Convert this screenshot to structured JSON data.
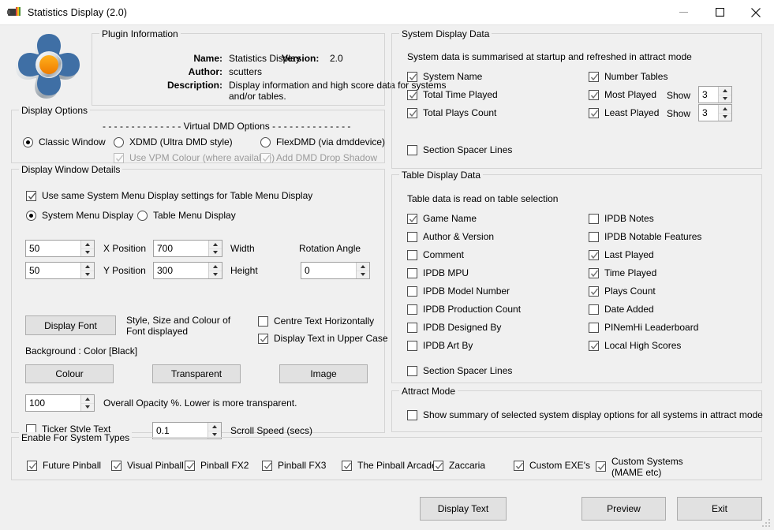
{
  "window": {
    "title": "Statistics Display (2.0)",
    "icon": "plugin-icon",
    "minimize": "–",
    "maximize": "□",
    "close": "✕"
  },
  "plugin_information": {
    "group_title": "Plugin Information",
    "name_label": "Name:",
    "name_value": "Statistics Display",
    "version_label": "Version:",
    "version_value": "2.0",
    "author_label": "Author:",
    "author_value": "scutters",
    "description_label": "Description:",
    "description_value_line1": "Display information and high score data for systems",
    "description_value_line2": "and/or tables."
  },
  "display_options": {
    "group_title": "Display Options",
    "virtual_dmd_header": "- - - - - - - - - - - - - -  Virtual DMD Options  - - - - - - - - - - - - - -",
    "radios": [
      {
        "label": "Classic Window",
        "checked": true
      },
      {
        "label": "XDMD (Ultra DMD style)",
        "checked": false
      },
      {
        "label": "FlexDMD (via dmddevice)",
        "checked": false
      }
    ],
    "checkboxes": [
      {
        "label": "Use VPM Colour (where available)",
        "checked": true,
        "disabled": true
      },
      {
        "label": "Add DMD Drop Shadow",
        "checked": true,
        "disabled": true
      }
    ]
  },
  "display_window_details": {
    "group_title": "Display Window Details",
    "use_same_settings": {
      "label": "Use same System Menu Display settings for Table Menu Display",
      "checked": true
    },
    "menu_radios": [
      {
        "label": "System Menu Display",
        "checked": true
      },
      {
        "label": "Table Menu Display",
        "checked": false
      }
    ],
    "x_position": {
      "value": "50",
      "label": "X Position"
    },
    "y_position": {
      "value": "50",
      "label": "Y Position"
    },
    "width": {
      "value": "700",
      "label": "Width"
    },
    "height": {
      "value": "300",
      "label": "Height"
    },
    "rotation_angle": {
      "value": "0",
      "label": "Rotation Angle"
    },
    "display_font_button": "Display Font",
    "font_note_line1": "Style, Size and Colour of",
    "font_note_line2": "Font displayed",
    "centre_text": {
      "label": "Centre Text Horizontally",
      "checked": false
    },
    "upper_case": {
      "label": "Display Text in Upper Case",
      "checked": true
    },
    "background_label": "Background : Color [Black]",
    "colour_button": "Colour",
    "transparent_button": "Transparent",
    "image_button": "Image",
    "opacity": {
      "value": "100",
      "label": "Overall Opacity %. Lower is more transparent."
    },
    "ticker_style": {
      "label": "Ticker Style Text",
      "checked": false
    },
    "scroll_speed": {
      "value": "0.1",
      "label": "Scroll Speed (secs)"
    }
  },
  "system_display_data": {
    "group_title": "System Display Data",
    "note": "System data is summarised at startup and refreshed in attract mode",
    "left_column": [
      {
        "label": "System Name",
        "checked": true
      },
      {
        "label": "Total Time Played",
        "checked": true
      },
      {
        "label": "Total Plays Count",
        "checked": true
      }
    ],
    "right_column": [
      {
        "label": "Number Tables",
        "checked": true
      },
      {
        "label": "Most Played",
        "checked": true,
        "show_label": "Show",
        "show_value": "3"
      },
      {
        "label": "Least Played",
        "checked": true,
        "show_label": "Show",
        "show_value": "3"
      }
    ],
    "section_spacer": {
      "label": "Section Spacer Lines",
      "checked": false
    }
  },
  "table_display_data": {
    "group_title": "Table Display Data",
    "note": "Table data is read on table selection",
    "left_column": [
      {
        "label": "Game Name",
        "checked": true
      },
      {
        "label": "Author & Version",
        "checked": false
      },
      {
        "label": "Comment",
        "checked": false
      },
      {
        "label": "IPDB MPU",
        "checked": false
      },
      {
        "label": "IPDB Model Number",
        "checked": false
      },
      {
        "label": "IPDB Production Count",
        "checked": false
      },
      {
        "label": "IPDB Designed By",
        "checked": false
      },
      {
        "label": "IPDB Art By",
        "checked": false
      }
    ],
    "right_column": [
      {
        "label": "IPDB Notes",
        "checked": false
      },
      {
        "label": "IPDB Notable Features",
        "checked": false
      },
      {
        "label": "Last Played",
        "checked": true
      },
      {
        "label": "Time Played",
        "checked": true
      },
      {
        "label": "Plays Count",
        "checked": true
      },
      {
        "label": "Date Added",
        "checked": false
      },
      {
        "label": "PINemHi Leaderboard",
        "checked": false
      },
      {
        "label": "Local High Scores",
        "checked": true
      }
    ],
    "section_spacer": {
      "label": "Section Spacer Lines",
      "checked": false
    }
  },
  "attract_mode": {
    "group_title": "Attract Mode",
    "checkbox": {
      "label": "Show summary of selected system display options for all systems in attract mode",
      "checked": false
    }
  },
  "enable_for_system_types": {
    "group_title": "Enable For System Types",
    "items": [
      {
        "label": "Future Pinball",
        "checked": true
      },
      {
        "label": "Visual Pinball",
        "checked": true
      },
      {
        "label": "Pinball FX2",
        "checked": true
      },
      {
        "label": "Pinball FX3",
        "checked": true
      },
      {
        "label": "The Pinball Arcade",
        "checked": true
      },
      {
        "label": "Zaccaria",
        "checked": true
      },
      {
        "label": "Custom EXE's",
        "checked": true
      },
      {
        "label": "Custom Systems\n(MAME etc)",
        "checked": true,
        "line1": "Custom Systems",
        "line2": "(MAME etc)"
      }
    ]
  },
  "footer": {
    "display_text_button": "Display Text",
    "preview_button": "Preview",
    "exit_button": "Exit"
  },
  "colors": {
    "window_bg": "#f0f0f0",
    "titlebar_bg": "#ffffff",
    "group_border": "#d4d4d4",
    "button_face": "#e1e1e1",
    "button_border": "#adadad",
    "logo_blue": "#3f6fa5",
    "logo_orange": "#f28c00"
  }
}
